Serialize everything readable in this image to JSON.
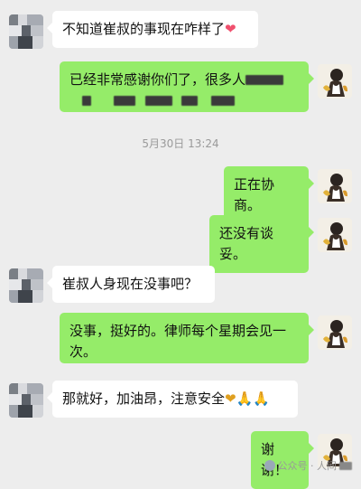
{
  "messages": [
    {
      "id": "m1",
      "side": "in",
      "text": "不知道崔叔的事现在咋样了",
      "emoji": "❤"
    },
    {
      "id": "m2",
      "side": "out",
      "line1": "已经非常感谢你们了，很多人",
      "line2": ""
    },
    {
      "id": "m3",
      "side": "out",
      "text": "正在协商。"
    },
    {
      "id": "m4",
      "side": "out",
      "text": "还没有谈妥。"
    },
    {
      "id": "m5",
      "side": "in",
      "text": "崔叔人身现在没事吧？"
    },
    {
      "id": "m6",
      "side": "out",
      "line1": "没事，挺好的。律师每个星期会见一",
      "line2": "次。"
    },
    {
      "id": "m7",
      "side": "in",
      "text": "那就好，加油昂，注意安全",
      "emoji": "❤🙏🙏"
    },
    {
      "id": "m8",
      "side": "out",
      "text": "谢谢！"
    }
  ],
  "timestamp": "5月30日 13:24",
  "watermark": {
    "text": "公众号 · 人间",
    "icon": "wechat-official-icon"
  },
  "colors": {
    "background": "#ededed",
    "outgoing_bubble": "#95ec69",
    "incoming_bubble": "#ffffff"
  }
}
